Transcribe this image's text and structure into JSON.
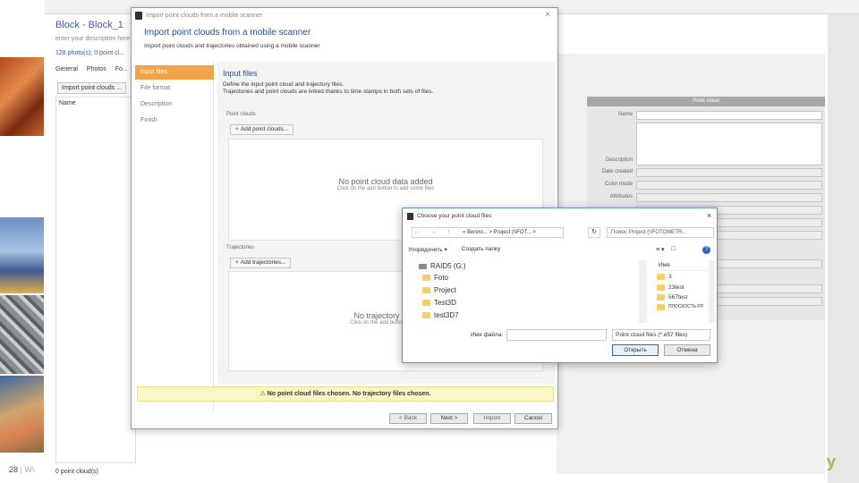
{
  "slide": {
    "page_number": "28",
    "page_suffix": "| W\\",
    "brand": "y"
  },
  "app": {
    "title": "Block - Block_1",
    "subtitle": "enter your description here",
    "info": "128 photo(s); 0 point cl...",
    "tabs": [
      "General",
      "Photos",
      "Fo..."
    ],
    "toolbar_btn": "Import point clouds ...",
    "list_header": "Name",
    "status": "0 point cloud(s)"
  },
  "props": {
    "header": "Point cloud",
    "labels": [
      "Name",
      "Description",
      "Date created",
      "Color mode",
      "Attributes"
    ]
  },
  "import_dialog": {
    "window_title": "Import point clouds from a mobile scanner",
    "close": "×",
    "heading": "Import point clouds from a mobile scanner",
    "subheading": "Import point clouds and trajectories obtained using a mobile scanner",
    "nav": [
      "Input files",
      "File format",
      "Description",
      "Finish"
    ],
    "body_title": "Input files",
    "body_desc_1": "Define the input point cloud and trajectory files.",
    "body_desc_2": "Trajectories and point clouds are linked thanks to time stamps in both sets of files.",
    "pc_group": "Point clouds",
    "add_pc": "Add point clouds...",
    "pc_empty": "No point cloud data added",
    "pc_empty_sub": "Click on the add button to add some files",
    "traj_group": "Trajectories",
    "add_traj": "Add trajectories...",
    "traj_empty": "No trajectory data",
    "traj_empty_sub": "Click on the add button to add",
    "warning": "No point cloud files chosen. No trajectory files chosen.",
    "btn_back": "< Back",
    "btn_next": "Next >",
    "btn_import": "Import",
    "btn_cancel": "Cancel"
  },
  "file_chooser": {
    "title": "Choose your point cloud files",
    "close": "×",
    "nav_arrows": "← → ↑",
    "address": "« Вилло...  >  Project (\\\\FOT...  >",
    "refresh": "↻",
    "search_placeholder": "Поиск: Project (\\\\FOTOMETR...",
    "organize": "Упорядочить ▾",
    "new_folder": "Создать папку",
    "view": "≡ ▾",
    "view2": "□",
    "help": "?",
    "tree": [
      {
        "type": "drive",
        "label": "RAID5 (G:)"
      },
      {
        "type": "folder",
        "label": "Foto"
      },
      {
        "type": "folder",
        "label": "Project"
      },
      {
        "type": "folder",
        "label": "Test3D"
      },
      {
        "type": "folder",
        "label": "test3D7"
      }
    ],
    "right_header": "Имя",
    "right_items": [
      "3",
      "23test",
      "567test",
      "ПЛОСКОСТЬ PP"
    ],
    "filename_label": "Имя файла:",
    "filename_value": "",
    "filter": "Point cloud files (*.e57 files)",
    "open": "Открыть",
    "cancel": "Отмена"
  },
  "colors": {
    "accent": "#f0a34a",
    "title_blue": "#2a4d8f",
    "warning_bg": "#fbf6c6"
  }
}
